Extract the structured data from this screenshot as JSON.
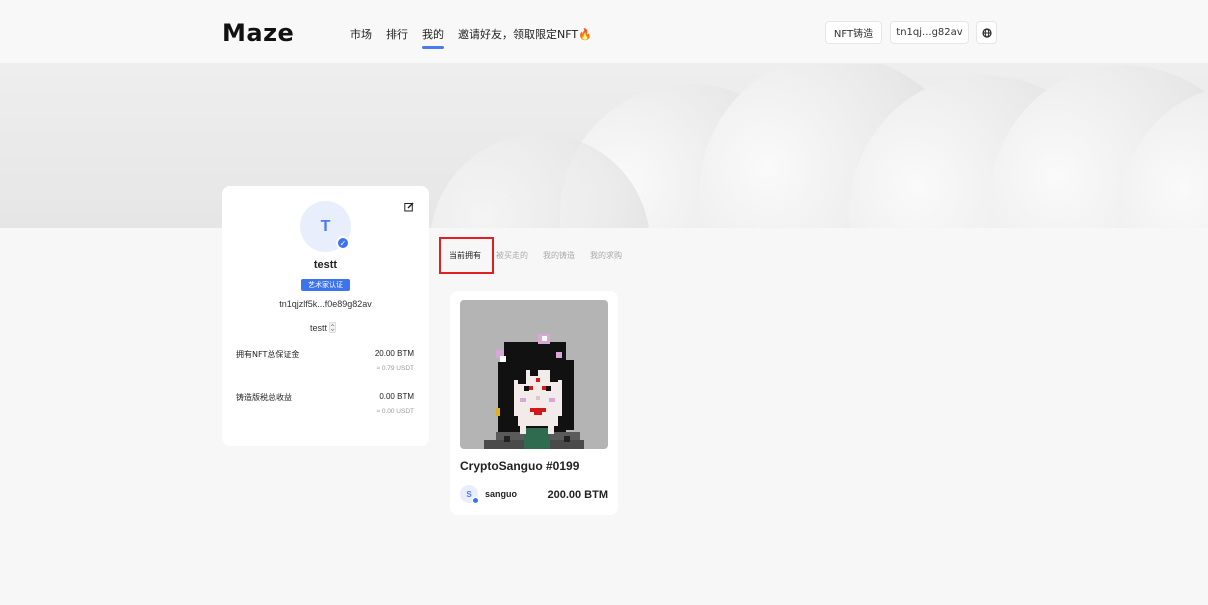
{
  "header": {
    "logo": "Maze",
    "nav": [
      {
        "label": "市场",
        "active": false
      },
      {
        "label": "排行",
        "active": false
      },
      {
        "label": "我的",
        "active": true
      },
      {
        "label": "邀请好友，领取限定NFT🔥",
        "active": false
      }
    ],
    "mint_button": "NFT铸造",
    "wallet_button": "tn1qj...g82av",
    "globe_icon": "globe-icon"
  },
  "profile": {
    "avatar_letter": "T",
    "username": "testt",
    "badge": "艺术家认证",
    "address": "tn1qjzlf5k...f0e89g82av",
    "select_value": "testt",
    "stats": [
      {
        "label": "拥有NFT总保证金",
        "value": "20.00 BTM",
        "sub": "≈ 0.79 USDT"
      },
      {
        "label": "铸造版税总收益",
        "value": "0.00 BTM",
        "sub": "≈ 0.00 USDT"
      }
    ]
  },
  "tabs": [
    {
      "label": "当前拥有",
      "active": true
    },
    {
      "label": "被买走的",
      "active": false
    },
    {
      "label": "我的铸造",
      "active": false
    },
    {
      "label": "我的求购",
      "active": false
    }
  ],
  "nfts": [
    {
      "title": "CryptoSanguo #0199",
      "creator_letter": "S",
      "creator": "sanguo",
      "price": "200.00 BTM"
    }
  ],
  "colors": {
    "accent": "#3c74f0",
    "highlight": "#e02020"
  }
}
